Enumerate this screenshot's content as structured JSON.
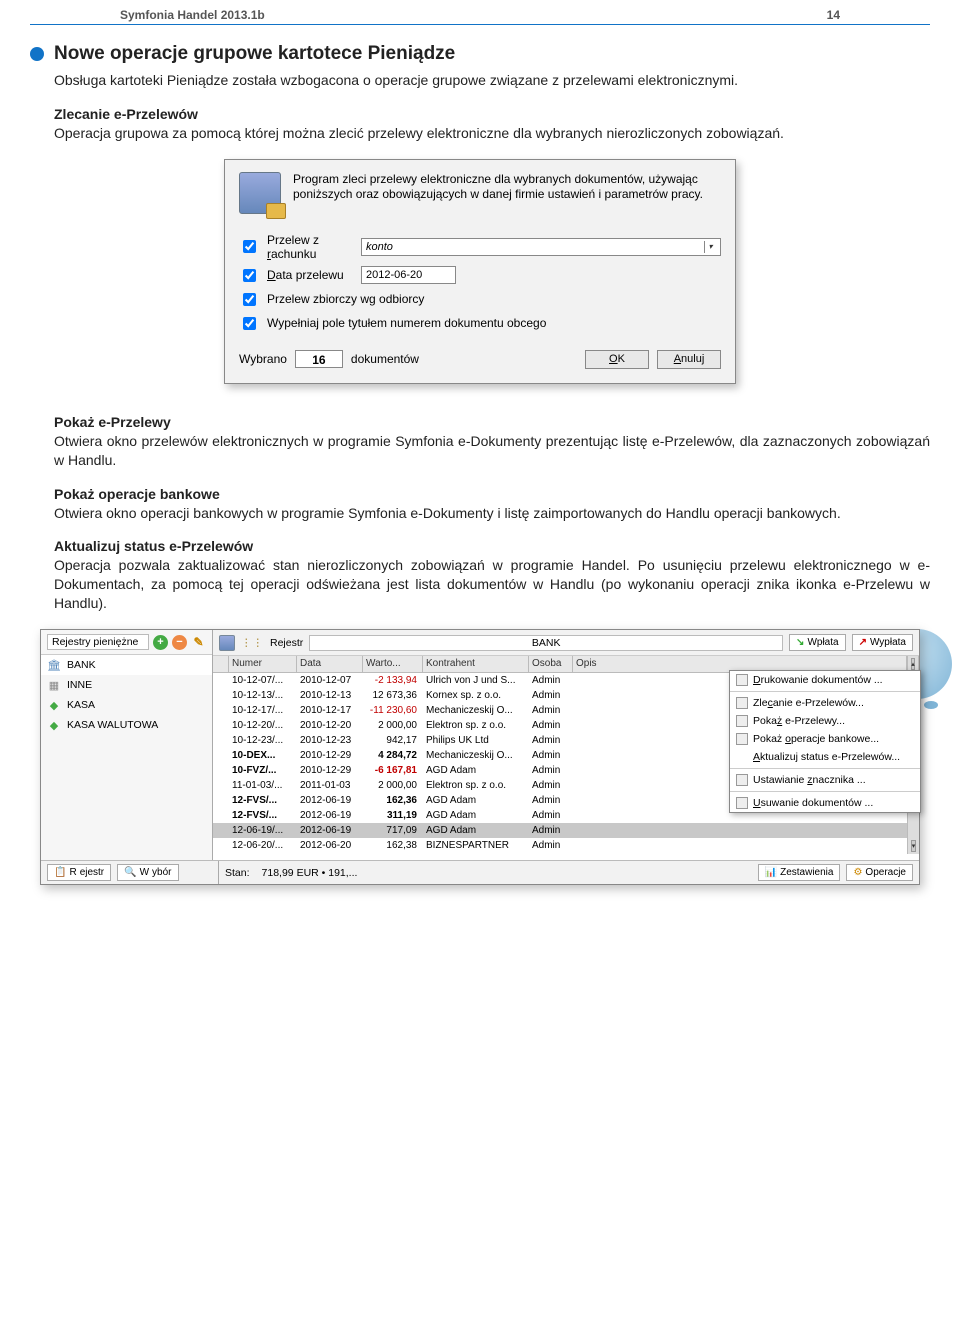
{
  "header": {
    "title": "Symfonia Handel 2013.1b",
    "page": "14"
  },
  "section1": {
    "title": "Nowe operacje grupowe kartotece Pieniądze",
    "intro": "Obsługa kartoteki Pieniądze została wzbogacona o operacje grupowe związane z przelewami elektronicznymi.",
    "sub1_title": "Zlecanie e-Przelewów",
    "sub1_body": "Operacja grupowa za pomocą której można zlecić przelewy elektroniczne dla wybranych nierozliczonych zobowiązań."
  },
  "dialog1": {
    "desc": "Program zleci przelewy elektroniczne dla wybranych dokumentów, używając poniższych oraz obowiązujących w danej firmie ustawień i parametrów pracy.",
    "chk1_pre": "Przelew z ",
    "chk1_ul": "r",
    "chk1_post": "achunku",
    "account_value": "konto",
    "chk2_ul": "D",
    "chk2_post": "ata przelewu",
    "date_value": "2012-06-20",
    "chk3": "Przelew zbiorczy wg odbiorcy",
    "chk4": "Wypełniaj pole tytułem numerem dokumentu obcego",
    "wybrano": "Wybrano",
    "count": "16",
    "dokumentow": "dokumentów",
    "ok_ul": "O",
    "ok_post": "K",
    "cancel_ul": "A",
    "cancel_post": "nuluj"
  },
  "section2": {
    "t1": "Pokaż e-Przelewy",
    "b1": "Otwiera okno przelewów elektronicznych w programie Symfonia e-Dokumenty prezentując listę e-Przelewów, dla zaznaczonych zobowiązań w Handlu.",
    "t2": "Pokaż operacje bankowe",
    "b2": "Otwiera okno operacji bankowych w programie Symfonia e-Dokumenty i listę zaimportowanych do Handlu operacji bankowych.",
    "t3": "Aktualizuj status e-Przelewów",
    "b3": "Operacja pozwala zaktualizować stan nierozliczonych zobowiązań w programie Handel. Po usunięciu przelewu elektronicznego w e-Dokumentach, za pomocą tej operacji odświeżana jest lista dokumentów w Handlu (po wykonaniu operacji znika ikonka e-Przelewu w Handlu)."
  },
  "win2": {
    "sidebar": {
      "title": "Rejestry pieniężne",
      "items": [
        "BANK",
        "INNE",
        "KASA",
        "KASA WALUTOWA"
      ]
    },
    "head": {
      "rejestr_label": "Rejestr",
      "rejestr_value": "BANK",
      "wplata": "Wpłata",
      "wyplata": "Wypłata"
    },
    "cols": [
      "",
      "Numer",
      "Data",
      "Warto...",
      "Kontrahent",
      "Osoba",
      "Opis"
    ],
    "rows": [
      {
        "num": "10-12-07/...",
        "date": "2010-12-07",
        "val": "-2 133,94",
        "neg": true,
        "kontr": "Ulrich von J und S...",
        "osoba": "Admin"
      },
      {
        "num": "10-12-13/...",
        "date": "2010-12-13",
        "val": "12 673,36",
        "kontr": "Kornex sp. z o.o.",
        "osoba": "Admin"
      },
      {
        "num": "10-12-17/...",
        "date": "2010-12-17",
        "val": "-11 230,60",
        "neg": true,
        "kontr": "Mechaniczeskij O...",
        "osoba": "Admin"
      },
      {
        "num": "10-12-20/...",
        "date": "2010-12-20",
        "val": "2 000,00",
        "kontr": "Elektron sp. z o.o.",
        "osoba": "Admin"
      },
      {
        "num": "10-12-23/...",
        "date": "2010-12-23",
        "val": "942,17",
        "kontr": "Philips UK Ltd",
        "osoba": "Admin"
      },
      {
        "num": "10-DEX...",
        "date": "2010-12-29",
        "val": "4 284,72",
        "bold": true,
        "kontr": "Mechaniczeskij O...",
        "osoba": "Admin"
      },
      {
        "num": "10-FVZ/...",
        "date": "2010-12-29",
        "val": "-6 167,81",
        "bold": true,
        "neg": true,
        "kontr": "AGD Adam",
        "osoba": "Admin"
      },
      {
        "num": "11-01-03/...",
        "date": "2011-01-03",
        "val": "2 000,00",
        "kontr": "Elektron sp. z o.o.",
        "osoba": "Admin"
      },
      {
        "num": "12-FVS/...",
        "date": "2012-06-19",
        "val": "162,36",
        "bold": true,
        "kontr": "AGD Adam",
        "osoba": "Admin"
      },
      {
        "num": "12-FVS/...",
        "date": "2012-06-19",
        "val": "311,19",
        "bold": true,
        "kontr": "AGD Adam",
        "osoba": "Admin"
      },
      {
        "num": "12-06-19/...",
        "date": "2012-06-19",
        "val": "717,09",
        "sel": true,
        "kontr": "AGD Adam",
        "osoba": "Admin"
      },
      {
        "num": "12-06-20/...",
        "date": "2012-06-20",
        "val": "162,38",
        "kontr": "BIZNESPARTNER",
        "osoba": "Admin"
      }
    ],
    "footer": {
      "rejestr": "Rejestr",
      "wybor": "Wybór",
      "stan_label": "Stan:",
      "stan_value": "718,99 EUR • 191,...",
      "zestawienia": "Zestawienia",
      "operacje": "Operacje"
    },
    "menu": {
      "druk_ul": "D",
      "druk_post": "rukowanie dokumentów ...",
      "zlec_pre": "Zle",
      "zlec_ul": "c",
      "zlec_post": "anie e-Przelewów...",
      "pokprz_pre": "Poka",
      "pokprz_ul": "ż",
      "pokprz_post": " e-Przelewy...",
      "pokop_pre": "Pokaż ",
      "pokop_ul": "o",
      "pokop_post": "peracje bankowe...",
      "akt_ul": "A",
      "akt_post": "ktualizuj status e-Przelewów...",
      "ust_pre": "Ustawianie ",
      "ust_ul": "z",
      "ust_post": "nacznika ...",
      "usuw_ul": "U",
      "usuw_post": "suwanie dokumentów ..."
    }
  }
}
